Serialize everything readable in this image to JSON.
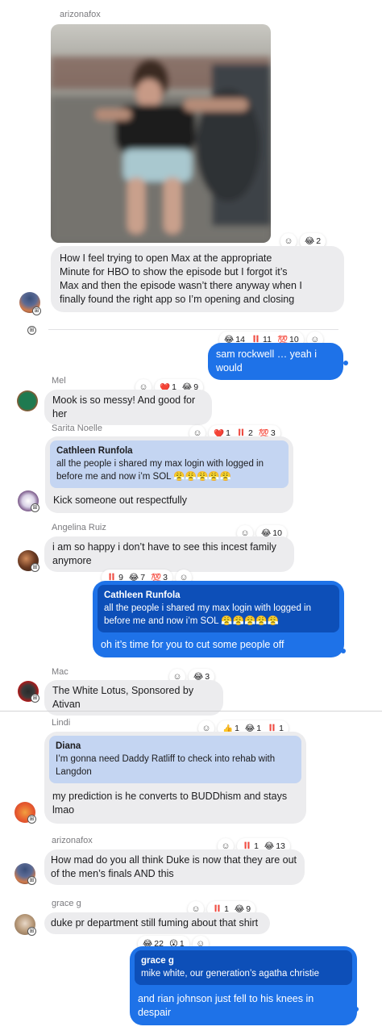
{
  "messages": [
    {
      "sender": "arizonafox",
      "image_desc": "blurred photo of woman running with outstretched arm",
      "reactions": [
        {
          "emoji": "😂",
          "count": "2"
        }
      ],
      "text": "How I feel trying to open Max at the appropriate\nMinute for HBO to show the episode but I forgot it’s\nMax and then the episode wasn’t there anyway when I\nfinally found the right app so I’m opening and closing"
    },
    {
      "sender": "",
      "reactions": [
        {
          "emoji": "😂",
          "count": "14"
        },
        {
          "emoji": "‼️",
          "count": "11"
        },
        {
          "emoji": "💯",
          "count": "10"
        }
      ],
      "text": "sam rockwell … yeah i would"
    },
    {
      "sender": "Mel",
      "reactions": [
        {
          "emoji": "❤️",
          "count": "1"
        },
        {
          "emoji": "😂",
          "count": "9"
        }
      ],
      "text": "Mook is so messy! And good for her"
    },
    {
      "sender": "Sarita Noelle",
      "reactions": [
        {
          "emoji": "❤️",
          "count": "1"
        },
        {
          "emoji": "‼️",
          "count": "2"
        },
        {
          "emoji": "💯",
          "count": "3"
        }
      ],
      "quote_name": "Cathleen Runfola",
      "quote_text": "all the people i shared my max login with logged in\nbefore me and now i’m SOL 😤😤😤😤😤",
      "text": "Kick someone out respectfully"
    },
    {
      "sender": "Angelina Ruiz",
      "reactions": [
        {
          "emoji": "😂",
          "count": "10"
        }
      ],
      "text": "i am so happy i don’t have to see this incest family\nanymore"
    },
    {
      "sender": "",
      "reactions": [
        {
          "emoji": "‼️",
          "count": "9"
        },
        {
          "emoji": "😂",
          "count": "7"
        },
        {
          "emoji": "💯",
          "count": "3"
        }
      ],
      "quote_name": "Cathleen Runfola",
      "quote_text": "all the people i shared my max login with logged in\nbefore me and now i’m SOL 😤😤😤😤😤",
      "text": "oh it’s time for you to cut some people off"
    },
    {
      "sender": "Mac",
      "reactions": [
        {
          "emoji": "😂",
          "count": "3"
        }
      ],
      "text": "The White Lotus, Sponsored by Ativan"
    },
    {
      "sender": "Lindi",
      "reactions": [
        {
          "emoji": "👍",
          "count": "1"
        },
        {
          "emoji": "😂",
          "count": "1"
        },
        {
          "emoji": "‼️",
          "count": "1"
        }
      ],
      "quote_name": "Diana",
      "quote_text": "I’m gonna need Daddy Ratliff to check into rehab with\nLangdon",
      "text": "my prediction is he converts to BUDDhism and stays\nlmao"
    },
    {
      "sender": "arizonafox",
      "reactions": [
        {
          "emoji": "‼️",
          "count": "1"
        },
        {
          "emoji": "😂",
          "count": "13"
        }
      ],
      "text": "How mad do you all think Duke is now that they are out\nof the men’s finals AND this"
    },
    {
      "sender": "grace g",
      "reactions": [
        {
          "emoji": "‼️",
          "count": "1"
        },
        {
          "emoji": "😂",
          "count": "9"
        }
      ],
      "text": "duke pr department still fuming about that shirt"
    },
    {
      "sender": "",
      "reactions": [
        {
          "emoji": "😂",
          "count": "22"
        },
        {
          "emoji": "😮",
          "count": "1"
        }
      ],
      "quote_name": "grace g",
      "quote_text": "mike white, our generation’s agatha christie",
      "text": "and rian johnson just fell to his knees in despair"
    }
  ],
  "icons": {
    "add_reaction": "add-reaction-icon",
    "avatar_badge": "messenger-badge-icon"
  },
  "colors": {
    "outgoing_bubble": "#1e72e8",
    "incoming_bubble": "#ececee",
    "quote_incoming": "#c4d5f2",
    "quote_outgoing": "#0d4fb8"
  }
}
